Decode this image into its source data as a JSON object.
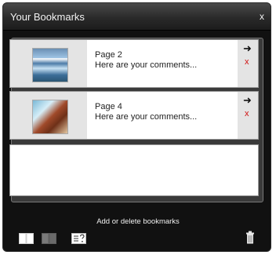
{
  "window": {
    "title": "Your Bookmarks",
    "close_label": "x"
  },
  "bookmarks": [
    {
      "page": "Page 2",
      "comment": "Here are your comments...",
      "go_icon": "arrow-right-icon",
      "delete_label": "x"
    },
    {
      "page": "Page 4",
      "comment": "Here are your comments...",
      "go_icon": "arrow-right-icon",
      "delete_label": "x"
    }
  ],
  "footer": {
    "hint": "Add or delete bookmarks",
    "tools": [
      "open-book-icon",
      "closed-book-icon",
      "note-help-icon",
      "trash-icon"
    ]
  },
  "colors": {
    "panel_bg": "#111111",
    "row_bg": "#ffffff",
    "delete_red": "#d01010"
  }
}
